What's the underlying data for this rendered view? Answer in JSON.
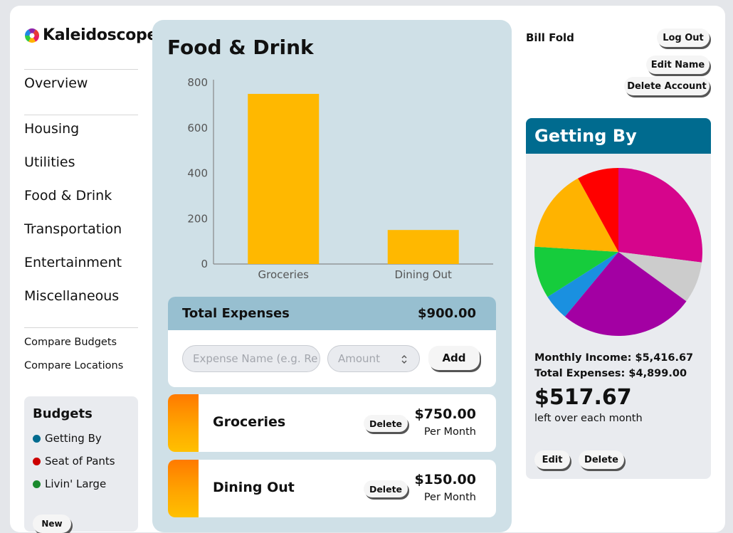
{
  "app": {
    "logo_text": "Kaleidoscope",
    "logo_colors": [
      "#e81e63",
      "#ffb300",
      "#2ecc40",
      "#1e88e5",
      "#8e24aa",
      "#e53935"
    ]
  },
  "sidebar": {
    "overview": "Overview",
    "categories": [
      "Housing",
      "Utilities",
      "Food & Drink",
      "Transportation",
      "Entertainment",
      "Miscellaneous"
    ],
    "compare_budgets": "Compare Budgets",
    "compare_locations": "Compare Locations",
    "budgets": {
      "title": "Budgets",
      "items": [
        {
          "label": "Getting By",
          "color": "#006b8f"
        },
        {
          "label": "Seat of Pants",
          "color": "#cc0000"
        },
        {
          "label": "Livin' Large",
          "color": "#1a8a2e"
        }
      ],
      "new_label": "New"
    }
  },
  "main": {
    "title": "Food & Drink",
    "total_label": "Total Expenses",
    "total_value": "$900.00",
    "name_placeholder": "Expense Name (e.g. Re",
    "amount_placeholder": "Amount",
    "add_label": "Add",
    "expenses": [
      {
        "name": "Groceries",
        "delete_label": "Delete",
        "amount": "$750.00",
        "period": "Per Month"
      },
      {
        "name": "Dining Out",
        "delete_label": "Delete",
        "amount": "$150.00",
        "period": "Per Month"
      }
    ]
  },
  "chart_data": {
    "type": "bar",
    "categories": [
      "Groceries",
      "Dining Out"
    ],
    "values": [
      750,
      150
    ],
    "yticks": [
      0,
      200,
      400,
      600,
      800
    ],
    "ylim": [
      0,
      800
    ],
    "bar_color": "#ffb800",
    "grid": false
  },
  "account": {
    "user_name": "Bill Fold",
    "logout_label": "Log Out",
    "edit_name_label": "Edit Name",
    "delete_account_label": "Delete Account"
  },
  "summary": {
    "title": "Getting By",
    "header_color": "#006b8f",
    "monthly_income": "Monthly Income: $5,416.67",
    "total_expenses": "Total Expenses: $4,899.00",
    "left_amount": "$517.67",
    "left_caption": "left over each month",
    "edit_label": "Edit",
    "delete_label": "Delete",
    "pie_chart": {
      "type": "pie",
      "slices": [
        {
          "color": "#d6058c",
          "value": 27
        },
        {
          "color": "#cccccc",
          "value": 8
        },
        {
          "color": "#a300a3",
          "value": 26
        },
        {
          "color": "#1a90e0",
          "value": 5
        },
        {
          "color": "#16cc3c",
          "value": 10
        },
        {
          "color": "#ffb300",
          "value": 16
        },
        {
          "color": "#ff0000",
          "value": 8
        }
      ]
    }
  }
}
